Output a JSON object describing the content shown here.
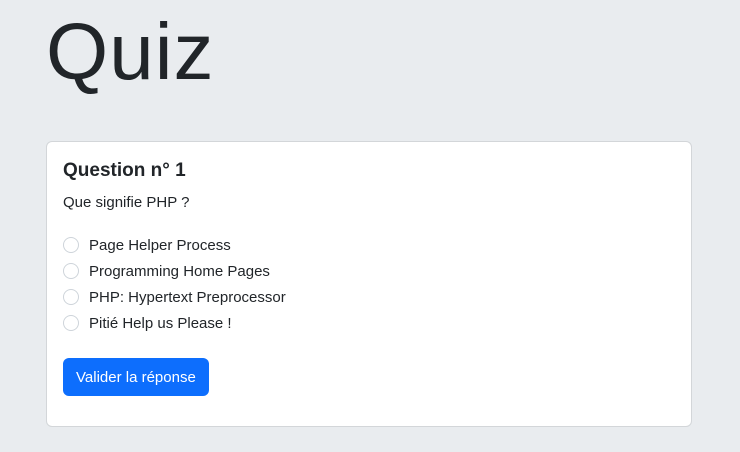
{
  "page": {
    "title": "Quiz"
  },
  "question": {
    "title": "Question n° 1",
    "text": "Que signifie PHP ?",
    "options": [
      {
        "label": "Page Helper Process",
        "checked": false
      },
      {
        "label": "Programming Home Pages",
        "checked": false
      },
      {
        "label": "PHP: Hypertext Preprocessor",
        "checked": false
      },
      {
        "label": "Pitié Help us Please !",
        "checked": false
      }
    ],
    "submit_label": "Valider la réponse"
  },
  "colors": {
    "primary": "#0d6efd",
    "background": "#e9ecef"
  }
}
